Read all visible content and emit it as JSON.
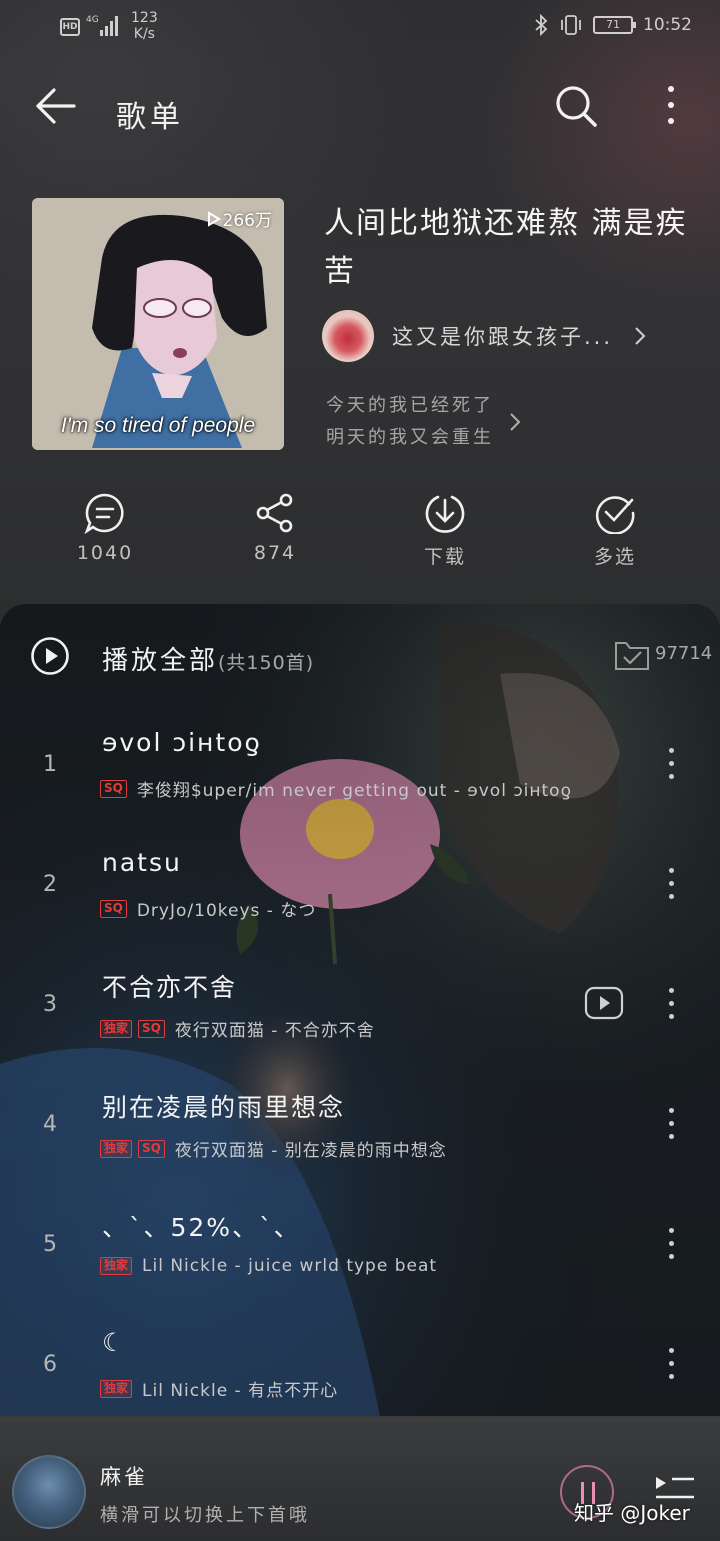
{
  "status_bar": {
    "hd": "HD",
    "network": "4G",
    "speed_value": "123",
    "speed_unit": "K/s",
    "battery": "71",
    "time": "10:52"
  },
  "header": {
    "title": "歌单",
    "icons": [
      "back-arrow-icon",
      "search-icon",
      "more-vertical-icon"
    ]
  },
  "playlist": {
    "play_count": "266万",
    "cover_caption": "I'm so tired of people",
    "title": "人间比地狱还难熬 满是疾苦",
    "creator": "这又是你跟女孩子...",
    "description_line1": "今天的我已经死了",
    "description_line2": "明天的我又会重生"
  },
  "actions": [
    {
      "icon": "comment-icon",
      "label": "1040"
    },
    {
      "icon": "share-icon",
      "label": "874"
    },
    {
      "icon": "download-icon",
      "label": "下载"
    },
    {
      "icon": "multi-select-icon",
      "label": "多选"
    }
  ],
  "song_list": {
    "play_all_label": "播放全部",
    "play_all_count": "(共150首)",
    "collect_count": "97714",
    "songs": [
      {
        "index": "1",
        "title": "ɘvol ɔiʜtoƍ",
        "tags": [
          "SQ"
        ],
        "meta": "李俊翔$uper/im never getting out - ɘvol ɔiʜtoƍ",
        "has_video": false
      },
      {
        "index": "2",
        "title": "natsu",
        "tags": [
          "SQ"
        ],
        "meta": "DryJo/10keys - なつ",
        "has_video": false
      },
      {
        "index": "3",
        "title": "不合亦不舍",
        "tags": [
          "独家",
          "SQ"
        ],
        "meta": "夜行双面猫 - 不合亦不舍",
        "has_video": true
      },
      {
        "index": "4",
        "title": "别在凌晨的雨里想念",
        "tags": [
          "独家",
          "SQ"
        ],
        "meta": "夜行双面猫 - 别在凌晨的雨中想念",
        "has_video": false
      },
      {
        "index": "5",
        "title": "、`、52%、`、",
        "tags": [
          "独家"
        ],
        "meta": "Lil Nickle - juice wrld type beat",
        "has_video": false
      },
      {
        "index": "6",
        "title": "☾",
        "tags": [
          "独家"
        ],
        "meta": "Lil Nickle - 有点不开心",
        "has_video": false
      }
    ]
  },
  "mini_player": {
    "title": "麻雀",
    "subtitle": "横滑可以切换上下首哦",
    "watermark": "知乎 @Joker"
  },
  "colors": {
    "accent_red": "#e23b3b",
    "pause_pink": "#e88fb2",
    "background": "#2e2f31"
  }
}
